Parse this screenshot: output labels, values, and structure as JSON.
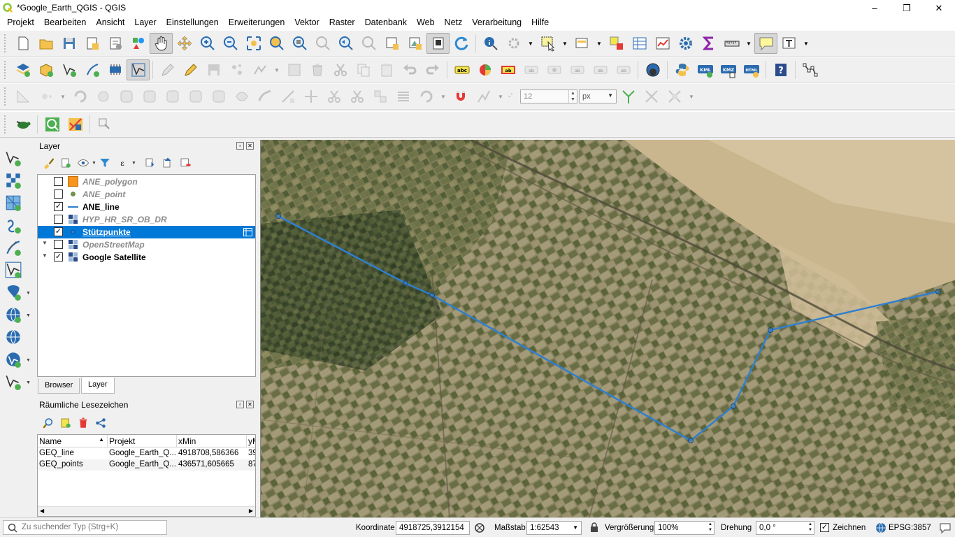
{
  "window": {
    "title": "*Google_Earth_QGIS - QGIS",
    "minimize": "–",
    "maximize": "❐",
    "close": "✕"
  },
  "menu": [
    "Projekt",
    "Bearbeiten",
    "Ansicht",
    "Layer",
    "Einstellungen",
    "Erweiterungen",
    "Vektor",
    "Raster",
    "Datenbank",
    "Web",
    "Netz",
    "Verarbeitung",
    "Hilfe"
  ],
  "digitize": {
    "tolerance": "12",
    "unit": "px"
  },
  "layers_panel": {
    "title": "Layer",
    "layers": [
      {
        "name": "ANE_polygon",
        "checked": false,
        "icon": "polygon-icon",
        "expander": ""
      },
      {
        "name": "ANE_point",
        "checked": false,
        "icon": "point-icon",
        "expander": ""
      },
      {
        "name": "ANE_line",
        "checked": true,
        "icon": "line-icon",
        "expander": ""
      },
      {
        "name": "HYP_HR_SR_OB_DR",
        "checked": false,
        "icon": "raster-icon",
        "expander": ""
      },
      {
        "name": "Stützpunkte",
        "checked": true,
        "icon": "point-icon",
        "expander": "",
        "selected": true
      },
      {
        "name": "OpenStreetMap",
        "checked": false,
        "icon": "raster-icon",
        "expander": "▼"
      },
      {
        "name": "Google Satellite",
        "checked": true,
        "icon": "raster-icon",
        "expander": "▼"
      }
    ],
    "tabs": [
      "Browser",
      "Layer"
    ]
  },
  "bookmarks_panel": {
    "title": "Räumliche Lesezeichen",
    "columns": [
      "Name",
      "Projekt",
      "xMin",
      "yM"
    ],
    "rows": [
      [
        "GEQ_line",
        "Google_Earth_Q...",
        "4918708,586366",
        "39"
      ],
      [
        "GEQ_points",
        "Google_Earth_Q...",
        "436571,605665",
        "87"
      ]
    ]
  },
  "status": {
    "search_placeholder": "Zu suchender Typ (Strg+K)",
    "coordinate_label": "Koordinate",
    "coordinate": "4918725,3912154",
    "scale_label": "Maßstab",
    "scale": "1:62543",
    "magnifier_label": "Vergrößerung",
    "magnifier": "100%",
    "rotation_label": "Drehung",
    "rotation": "0,0 °",
    "render_label": "Zeichnen",
    "crs": "EPSG:3857"
  },
  "colors": {
    "accent": "#0078d7",
    "line": "#2f7fd0",
    "polygon": "#f7941d"
  }
}
